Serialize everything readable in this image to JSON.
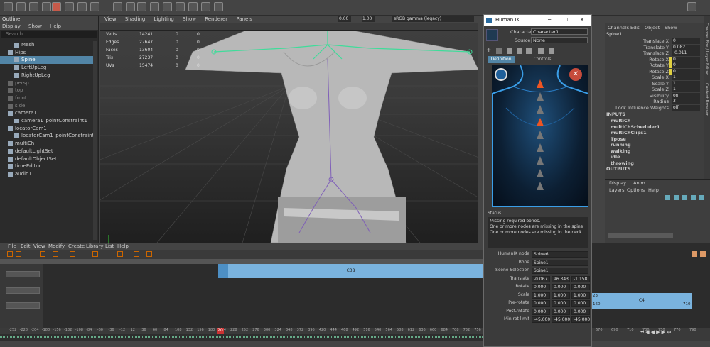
{
  "outliner": {
    "title": "Outliner",
    "menu": [
      "Display",
      "Show",
      "Help"
    ],
    "search_placeholder": "Search...",
    "items": [
      {
        "label": "Mesh",
        "indent": 2,
        "state": "normal"
      },
      {
        "label": "Hips",
        "indent": 1,
        "state": "normal"
      },
      {
        "label": "Spine",
        "indent": 2,
        "state": "selected"
      },
      {
        "label": "LeftUpLeg",
        "indent": 2,
        "state": "normal"
      },
      {
        "label": "RightUpLeg",
        "indent": 2,
        "state": "normal"
      },
      {
        "label": "persp",
        "indent": 1,
        "state": "dim"
      },
      {
        "label": "top",
        "indent": 1,
        "state": "dim"
      },
      {
        "label": "front",
        "indent": 1,
        "state": "dim"
      },
      {
        "label": "side",
        "indent": 1,
        "state": "dim"
      },
      {
        "label": "camera1",
        "indent": 1,
        "state": "normal"
      },
      {
        "label": "camera1_pointConstraint1",
        "indent": 2,
        "state": "normal"
      },
      {
        "label": "locatorCam1",
        "indent": 1,
        "state": "normal"
      },
      {
        "label": "locatorCam1_pointConstraint1",
        "indent": 2,
        "state": "normal"
      },
      {
        "label": "multiCh",
        "indent": 1,
        "state": "normal"
      },
      {
        "label": "defaultLightSet",
        "indent": 1,
        "state": "normal"
      },
      {
        "label": "defaultObjectSet",
        "indent": 1,
        "state": "normal"
      },
      {
        "label": "timeEditor",
        "indent": 1,
        "state": "normal"
      },
      {
        "label": "audio1",
        "indent": 1,
        "state": "normal"
      }
    ]
  },
  "viewport": {
    "menu": [
      "View",
      "Shading",
      "Lighting",
      "Show",
      "Renderer",
      "Panels"
    ],
    "field1": "0.00",
    "field2": "1.00",
    "colorspace": "sRGB gamma (legacy)",
    "hud": [
      {
        "label": "Verts",
        "v1": "14241",
        "v2": "0",
        "v3": "0"
      },
      {
        "label": "Edges",
        "v1": "27647",
        "v2": "0",
        "v3": "0"
      },
      {
        "label": "Faces",
        "v1": "13604",
        "v2": "0",
        "v3": "0"
      },
      {
        "label": "Tris",
        "v1": "27237",
        "v2": "0",
        "v3": "0"
      },
      {
        "label": "UVs",
        "v1": "15474",
        "v2": "0",
        "v3": "0"
      }
    ]
  },
  "humanik": {
    "title": "Human IK",
    "character_label": "Character:",
    "character_value": "Character1",
    "source_label": "Source:",
    "source_value": "None",
    "tabs": [
      "Definition",
      "Controls"
    ],
    "status_label": "Status",
    "status_lines": [
      "Missing required bones.",
      "One or more nodes are missing in the spine",
      "One or more nodes are missing in the neck"
    ],
    "props": [
      {
        "label": "HumanIK node",
        "values": [
          "Spine6"
        ]
      },
      {
        "label": "Bone",
        "values": [
          "Spine1"
        ]
      },
      {
        "label": "Scene Selection",
        "values": [
          "Spine1"
        ]
      },
      {
        "label": "Translate",
        "values": [
          "-0.067",
          "96.343",
          "-1.158"
        ]
      },
      {
        "label": "Rotate",
        "values": [
          "0.000",
          "0.000",
          "0.000"
        ]
      },
      {
        "label": "Scale",
        "values": [
          "1.000",
          "1.000",
          "1.000"
        ]
      },
      {
        "label": "Pre-rotate",
        "values": [
          "0.000",
          "0.000",
          "0.000"
        ]
      },
      {
        "label": "Post-rotate",
        "values": [
          "0.000",
          "0.000",
          "0.000"
        ]
      },
      {
        "label": "Min rot limit",
        "values": [
          "-45.000",
          "-45.000",
          "-45.000"
        ]
      }
    ]
  },
  "channels": {
    "menu": [
      "Channels",
      "Edit",
      "Object",
      "Show"
    ],
    "node": "Spine1",
    "attrs": [
      {
        "label": "Translate X",
        "value": "0"
      },
      {
        "label": "Translate Y",
        "value": "0.082"
      },
      {
        "label": "Translate Z",
        "value": "-0.011"
      },
      {
        "label": "Rotate X",
        "value": "0"
      },
      {
        "label": "Rotate Y",
        "value": "0"
      },
      {
        "label": "Rotate Z",
        "value": "0"
      },
      {
        "label": "Scale X",
        "value": "1"
      },
      {
        "label": "Scale Y",
        "value": "1"
      },
      {
        "label": "Scale Z",
        "value": "1"
      },
      {
        "label": "Visibility",
        "value": "on"
      },
      {
        "label": "Radius",
        "value": "3"
      },
      {
        "label": "Lock Influence Weights",
        "value": "off"
      }
    ],
    "inputs_header": "INPUTS",
    "inputs": [
      "multiCh",
      "multiChScheduler1",
      "multiChClips1",
      "Tpose",
      "running",
      "walking",
      "idle",
      "throwing"
    ],
    "outputs_header": "OUTPUTS",
    "layer_tabs": [
      "Display",
      "Anim"
    ],
    "layer_menu": [
      "Layers",
      "Options",
      "Help"
    ],
    "side_tabs": [
      "Channel Box / Layer Editor",
      "Content Browser"
    ]
  },
  "timeeditor": {
    "menu": [
      "File",
      "Edit",
      "View",
      "Modify",
      "Create",
      "Library",
      "List",
      "Help"
    ],
    "clip1": "C38",
    "clip2": "C4",
    "clip2_start": "23",
    "clip2_end": "710",
    "clip2_sub": "160"
  },
  "timeline": {
    "ticks": [
      "-252",
      "-228",
      "-204",
      "-180",
      "-156",
      "-132",
      "-108",
      "-84",
      "-60",
      "-36",
      "-12",
      "12",
      "36",
      "60",
      "84",
      "108",
      "132",
      "156",
      "180",
      "204",
      "228",
      "252",
      "276",
      "300",
      "324",
      "348",
      "372",
      "396",
      "420",
      "444",
      "468",
      "492",
      "516",
      "540",
      "564",
      "588",
      "612",
      "636",
      "660",
      "684",
      "708",
      "732",
      "756",
      "780",
      "804",
      "828",
      "852",
      "876",
      "900",
      "924",
      "948",
      "972"
    ],
    "frame": "20",
    "right_ticks": [
      "670",
      "690",
      "710",
      "730",
      "750",
      "770",
      "790"
    ]
  }
}
